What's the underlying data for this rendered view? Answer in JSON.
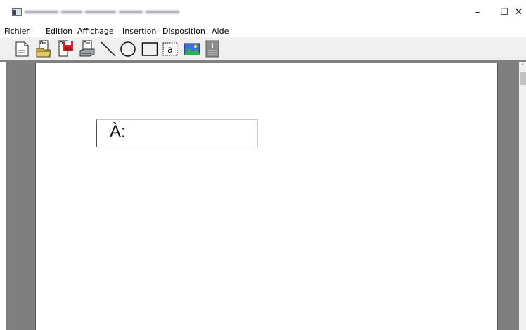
{
  "window": {
    "minimize_glyph": "–",
    "maximize_glyph": "☐",
    "close_glyph": "✕"
  },
  "menu": [
    {
      "label": "Fichier"
    },
    {
      "label": "Edition"
    },
    {
      "label": "Affichage"
    },
    {
      "label": "Insertion"
    },
    {
      "label": "Disposition"
    },
    {
      "label": "Aide"
    }
  ],
  "toolbar": {
    "tools": [
      "new-document-icon",
      "open-document-icon",
      "save-document-icon",
      "print-document-icon",
      "line-tool-icon",
      "ellipse-tool-icon",
      "rectangle-tool-icon",
      "text-tool-icon",
      "image-tool-icon",
      "info-icon"
    ],
    "text_tool_glyph": "a"
  },
  "document": {
    "address_label": "À:"
  },
  "colors": {
    "workspace": "#7f7f7f",
    "toolbar": "#f0f0f0",
    "save_red": "#d7262d",
    "image_green": "#27b54a",
    "image_blue": "#3b6fd9"
  }
}
